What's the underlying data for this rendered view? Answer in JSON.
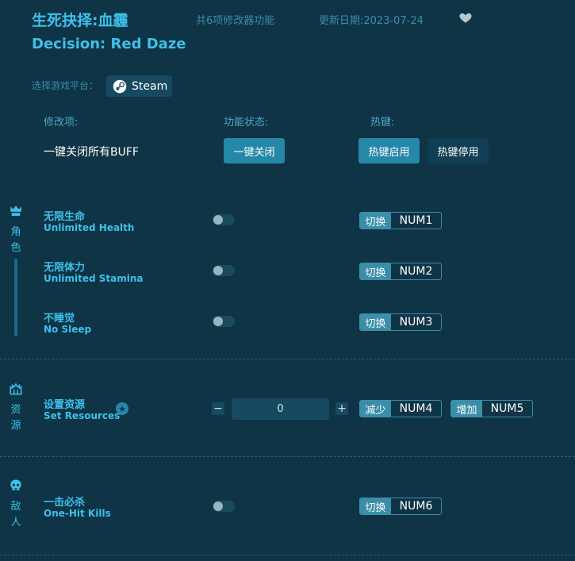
{
  "header": {
    "title_cn": "生死抉择:血霾",
    "feature_count": "共6项修改器功能",
    "update_date": "更新日期:2023-07-24",
    "title_en": "Decision: Red Daze",
    "favorite_icon": "heart-icon"
  },
  "platform": {
    "label": "选择游戏平台：",
    "button": "Steam",
    "icon": "steam-icon"
  },
  "columns": {
    "mod": "修改项:",
    "status": "功能状态:",
    "hotkey": "热键:"
  },
  "global": {
    "label": "一键关闭所有BUFF",
    "close_all": "一键关闭",
    "hotkeys_on": "热键启用",
    "hotkeys_off": "热键停用"
  },
  "sections": {
    "character": {
      "label": "角色",
      "icon": "character-icon"
    },
    "resources": {
      "label": "资源",
      "icon": "resources-icon"
    },
    "enemy": {
      "label": "敌人",
      "icon": "skull-icon"
    }
  },
  "items": [
    {
      "cn": "无限生命",
      "en": "Unlimited Health",
      "action": "切换",
      "key": "NUM1",
      "enabled": false
    },
    {
      "cn": "无限体力",
      "en": "Unlimited Stamina",
      "action": "切换",
      "key": "NUM2",
      "enabled": false
    },
    {
      "cn": "不睡觉",
      "en": "No Sleep",
      "action": "切换",
      "key": "NUM3",
      "enabled": false
    },
    {
      "cn": "一击必杀",
      "en": "One-Hit Kills",
      "action": "切换",
      "key": "NUM6",
      "enabled": false
    }
  ],
  "resource": {
    "cn": "设置资源",
    "en": "Set Resources",
    "value": "0",
    "minus": "−",
    "plus": "+",
    "decrease_action": "减少",
    "decrease_key": "NUM4",
    "increase_action": "增加",
    "increase_key": "NUM5"
  },
  "colors": {
    "background": "#0e3446",
    "accent": "#3ec0ea",
    "button": "#2688a8"
  }
}
